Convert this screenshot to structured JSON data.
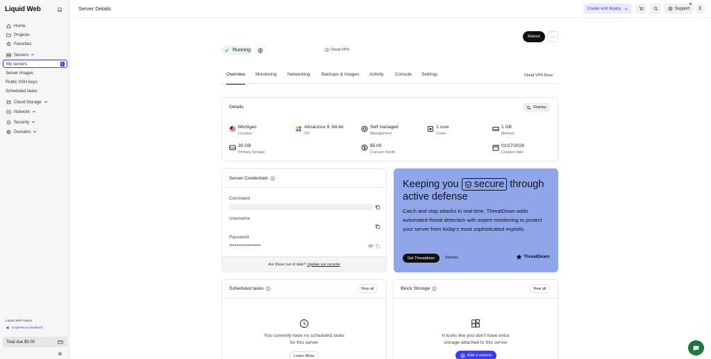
{
  "brand": {
    "logo": "Liquid Web"
  },
  "sidebar": {
    "items": [
      {
        "label": "Home",
        "icon": "home-icon"
      },
      {
        "label": "Projects",
        "icon": "folder-icon"
      },
      {
        "label": "Favorites",
        "icon": "star-icon"
      },
      {
        "label": "Servers",
        "icon": "server-icon",
        "expanded": true
      },
      {
        "label": "My servers",
        "badge": "1",
        "active": true
      },
      {
        "label": "Server images"
      },
      {
        "label": "Public SSH keys"
      },
      {
        "label": "Scheduled tasks"
      },
      {
        "label": "Cloud Storage",
        "icon": "cloud-storage-icon"
      },
      {
        "label": "Network",
        "icon": "network-icon"
      },
      {
        "label": "Security",
        "icon": "shield-icon"
      },
      {
        "label": "Domains",
        "icon": "globe-icon"
      }
    ],
    "status_link": "Liquid Web status",
    "feedback_link": "Experience feedback",
    "total_due": "Total due $0.00"
  },
  "topbar": {
    "title": "Server Details",
    "create_label": "Create and deploy",
    "support_label": "Support",
    "avatar_initial": "E"
  },
  "server": {
    "reboot_label": "Reboot",
    "more_label": "···",
    "status": "Running",
    "type_tag": "Cloud VPS"
  },
  "tabs": [
    "Overview",
    "Monitoring",
    "Networking",
    "Backups & Images",
    "Activity",
    "Console",
    "Settings"
  ],
  "docs_link": "Cloud VPS Docs",
  "details": {
    "title": "Details",
    "display_label": "Display",
    "items": [
      {
        "value": "Michigan",
        "label": "Location",
        "icon": "us-flag-icon"
      },
      {
        "value": "AlmaLinux 9, 64-bit",
        "label": "OS",
        "icon": "almalinux-icon"
      },
      {
        "value": "Self managed",
        "label": "Management",
        "icon": "support-ring-icon"
      },
      {
        "value": "1 core",
        "label": "Cores",
        "icon": "cpu-icon"
      },
      {
        "value": "1 GB",
        "label": "Memory",
        "icon": "memory-icon"
      },
      {
        "value": "30 GB",
        "label": "Primary Storage",
        "icon": "disk-icon"
      },
      {
        "value": "$5.00",
        "label": "Cost per month",
        "icon": "dollar-icon"
      },
      {
        "value": "01/27/2026",
        "label": "Creation date",
        "icon": "calendar-icon"
      }
    ]
  },
  "credentials": {
    "title": "Server Credentials",
    "command_label": "Command",
    "username_label": "Username",
    "password_label": "Password",
    "password_value": "•••••••••••••••••",
    "footer_text": "Are these out of date?",
    "footer_link": "Update our records"
  },
  "promo": {
    "headline_pre": "Keeping you",
    "headline_secure": "secure",
    "headline_post": "through active defense",
    "body": "Catch and stop attacks in real time. ThreatDown adds automated threat detection with expert monitoring to protect your server from today's most sophisticated exploits.",
    "cta_label": "Get Threatdown",
    "dismiss_label": "Dismiss",
    "logo_text": "ThreatDown"
  },
  "scheduled": {
    "title": "Scheduled tasks",
    "view_all": "View all",
    "empty_text": "You currently have no scheduled tasks for this server",
    "learn_more": "Learn More"
  },
  "block_storage": {
    "title": "Block Storage",
    "view_all": "View all",
    "empty_text": "It looks like you don't have extra storage attached to this server",
    "add_label": "Add a volume"
  },
  "colors": {
    "accent": "#3b3bf0",
    "running_bg": "#e9f7ee",
    "promo_bg": "#8fa6ea",
    "chat": "#1b7a3a"
  }
}
